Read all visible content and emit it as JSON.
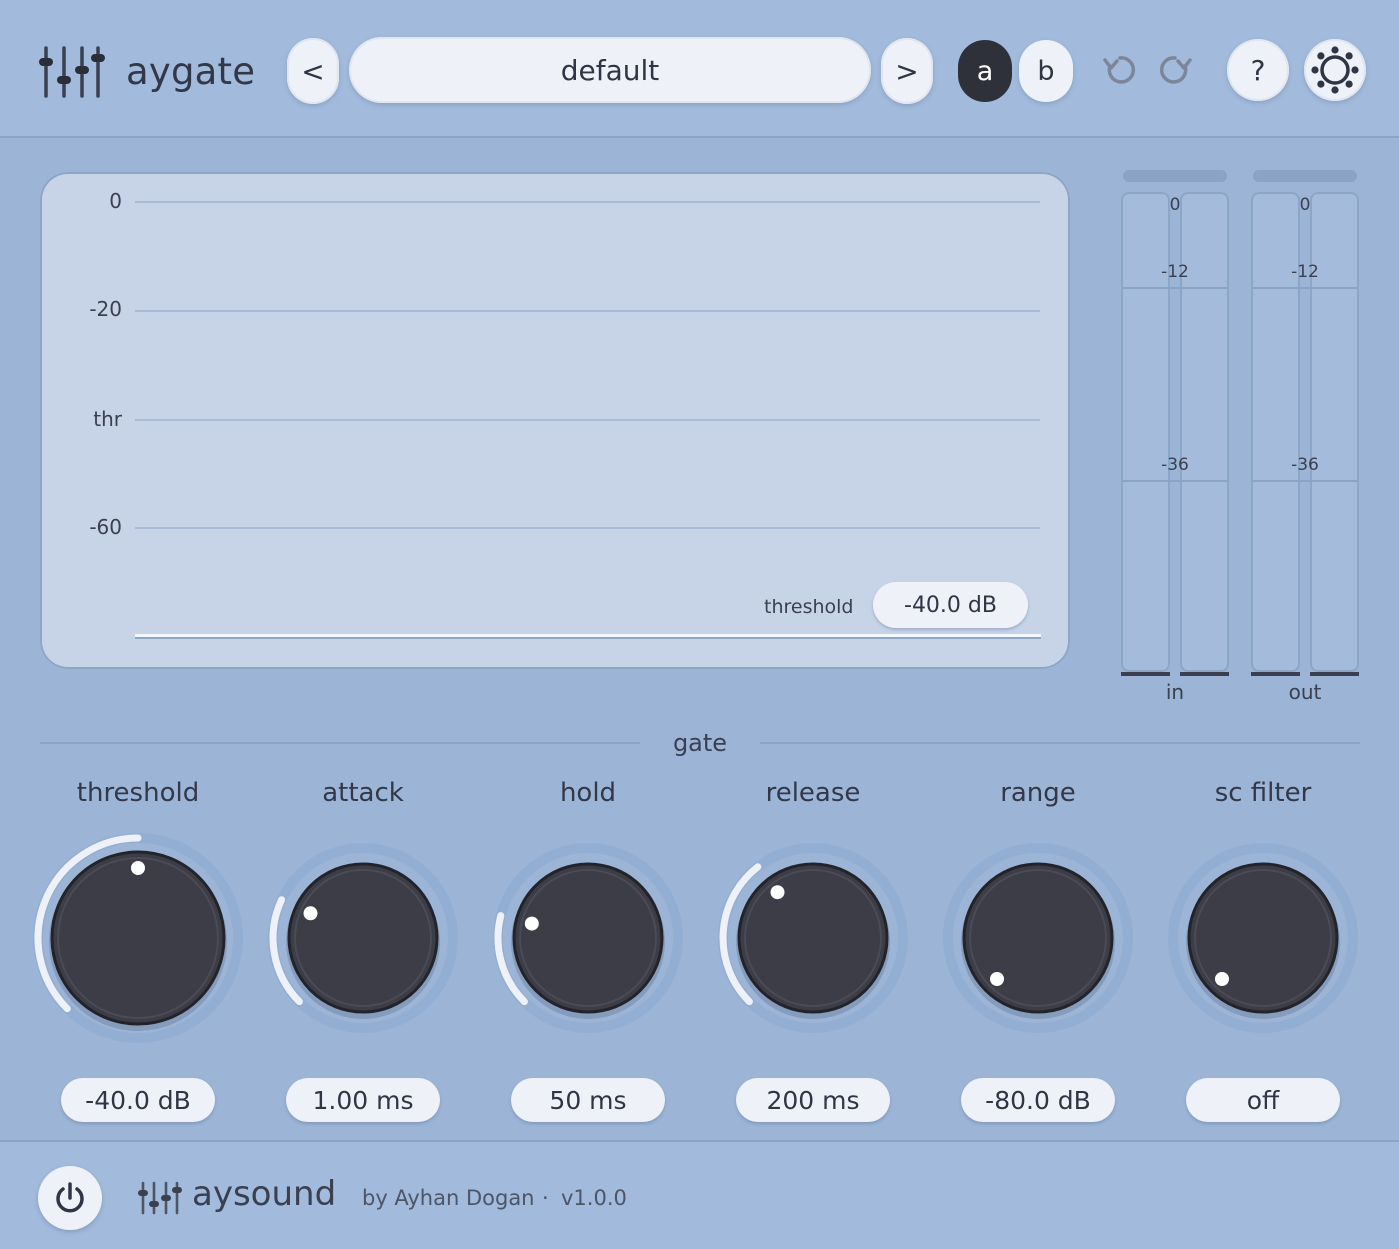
{
  "header": {
    "app_name": "aygate",
    "prev_label": "<",
    "next_label": ">",
    "preset_name": "default",
    "ab_a": "a",
    "ab_b": "b",
    "help_label": "?"
  },
  "display": {
    "labels": [
      "0",
      "-20",
      "thr",
      "-60"
    ],
    "threshold_caption": "threshold",
    "threshold_value": "-40.0 dB"
  },
  "meters": {
    "in": {
      "name": "in",
      "scale": [
        "0",
        "-12",
        "-36"
      ]
    },
    "out": {
      "name": "out",
      "scale": [
        "0",
        "-12",
        "-36"
      ]
    }
  },
  "gate": {
    "title": "gate",
    "knobs": [
      {
        "label": "threshold",
        "value": "-40.0 dB",
        "level": 0.5
      },
      {
        "label": "attack",
        "value": "1.00 ms",
        "level": 0.26
      },
      {
        "label": "hold",
        "value": "50 ms",
        "level": 0.22
      },
      {
        "label": "release",
        "value": "200 ms",
        "level": 0.36
      },
      {
        "label": "range",
        "value": "-80.0 dB",
        "level": 0.0
      },
      {
        "label": "sc filter",
        "value": "off",
        "level": 0.0
      }
    ]
  },
  "footer": {
    "brand": "aysound",
    "by": "by Ayhan Dogan",
    "dot": "·",
    "version": "v1.0.0"
  }
}
